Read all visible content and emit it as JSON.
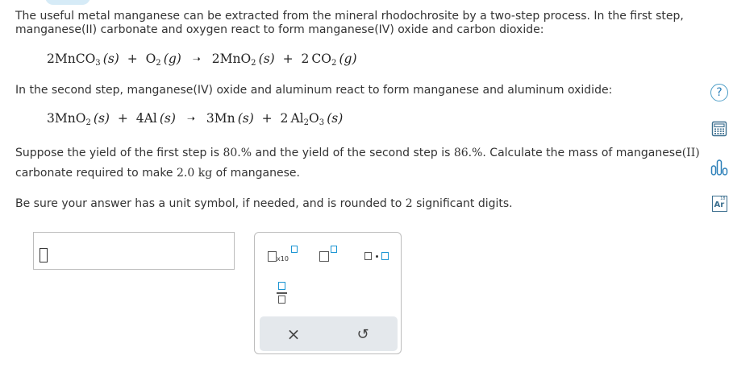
{
  "question": {
    "intro_line1": "The useful metal manganese can be extracted from the mineral rhodochrosite by a two-step process. In the first step,",
    "intro_line2": "manganese(II) carbonate and oxygen react to form manganese(IV) oxide and carbon dioxide:",
    "equation1": {
      "coef_a": "2",
      "r1": "MnCO",
      "r1_sub": "3",
      "r1_state": "(s)",
      "plus1": "+",
      "r2": "O",
      "r2_sub": "2",
      "r2_state": "(g)",
      "arrow": "➝",
      "coef_p1": "2",
      "p1": "MnO",
      "p1_sub": "2",
      "p1_state": "(s)",
      "plus2": "+",
      "coef_p2": "2",
      "p2": "CO",
      "p2_sub": "2",
      "p2_state": "(g)"
    },
    "step2_line": "In the second step, manganese(IV) oxide and aluminum react to form manganese and aluminum oxidide:",
    "equation2": {
      "coef_a": "3",
      "r1": "MnO",
      "r1_sub": "2",
      "r1_state": "(s)",
      "plus1": "+",
      "coef_b": "4",
      "r2": "Al",
      "r2_state": "(s)",
      "arrow": "➝",
      "coef_p1": "3",
      "p1": "Mn",
      "p1_state": "(s)",
      "plus2": "+",
      "coef_p2": "2",
      "p2": "Al",
      "p2_sub": "2",
      "p2_o": "O",
      "p2_o_sub": "3",
      "p2_state": "(s)"
    },
    "yield_line1_a": "Suppose the yield of the first step is ",
    "yield1": "80.%",
    "yield_line1_b": " and the yield of the second step is ",
    "yield2": "86.%",
    "yield_line1_c": ". Calculate the mass of manganese",
    "yield_line1_d": "(II)",
    "yield_line2_a": "carbonate required to make ",
    "mass_value": "2.0 kg",
    "yield_line2_b": " of manganese.",
    "instr_a": "Be sure your answer has a unit symbol, if needed, and is rounded to ",
    "sig_figs": "2",
    "instr_b": " significant digits."
  },
  "answer": {
    "value": ""
  },
  "palette": {
    "x10_label": "x10",
    "clear_symbol": "×",
    "undo_symbol": "↺"
  },
  "side_tools": {
    "help_label": "?",
    "periodic_label_top": "18",
    "periodic_label": "Ar"
  },
  "colors": {
    "accent": "#1b95d3",
    "help": "#2b7fb8"
  }
}
